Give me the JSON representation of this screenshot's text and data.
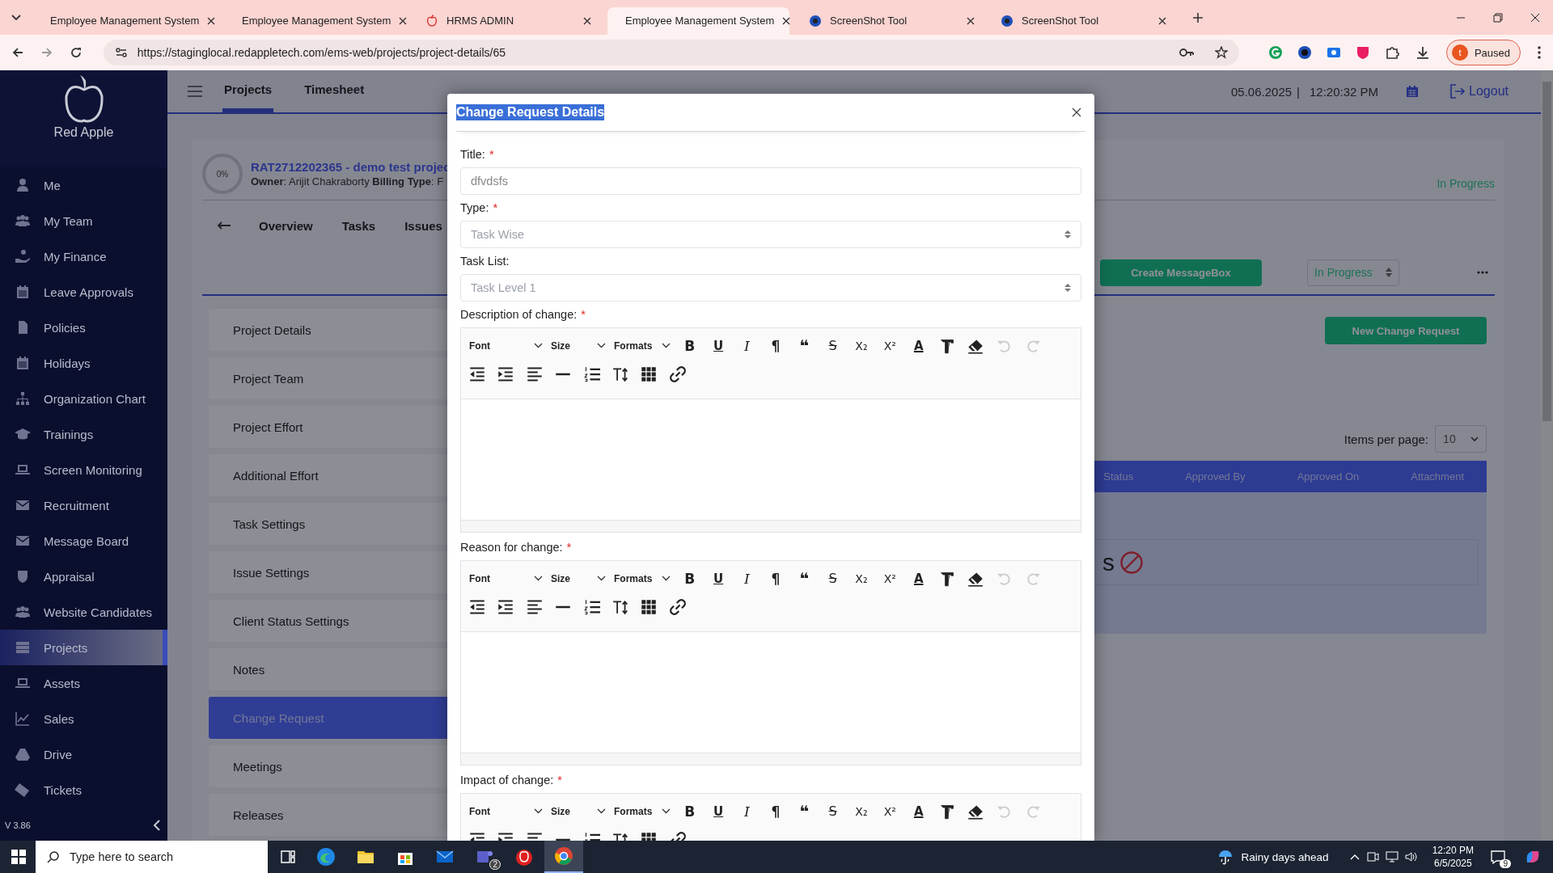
{
  "browser": {
    "tabs": [
      {
        "title": "Employee Management System",
        "selected": false
      },
      {
        "title": "Employee Management System",
        "selected": false
      },
      {
        "title": "HRMS ADMIN",
        "selected": false
      },
      {
        "title": "Employee Management System",
        "selected": true
      },
      {
        "title": "ScreenShot Tool",
        "selected": false
      },
      {
        "title": "ScreenShot Tool",
        "selected": false
      }
    ],
    "url": "https://staginglocal.redappletech.com/ems-web/projects/project-details/65",
    "profile": {
      "initial": "t",
      "status": "Paused"
    }
  },
  "sidebar": {
    "brand": "Red Apple",
    "items": [
      {
        "label": "Me",
        "selected": false
      },
      {
        "label": "My Team",
        "selected": false
      },
      {
        "label": "My Finance",
        "selected": false
      },
      {
        "label": "Leave Approvals",
        "selected": false
      },
      {
        "label": "Policies",
        "selected": false
      },
      {
        "label": "Holidays",
        "selected": false
      },
      {
        "label": "Organization Chart",
        "selected": false
      },
      {
        "label": "Trainings",
        "selected": false
      },
      {
        "label": "Screen Monitoring",
        "selected": false
      },
      {
        "label": "Recruitment",
        "selected": false
      },
      {
        "label": "Message Board",
        "selected": false
      },
      {
        "label": "Appraisal",
        "selected": false
      },
      {
        "label": "Website Candidates",
        "selected": false
      },
      {
        "label": "Projects",
        "selected": true
      },
      {
        "label": "Assets",
        "selected": false
      },
      {
        "label": "Sales",
        "selected": false
      },
      {
        "label": "Drive",
        "selected": false
      },
      {
        "label": "Tickets",
        "selected": false
      }
    ],
    "version": "V 3.86"
  },
  "header": {
    "tabs": [
      {
        "label": "Projects",
        "selected": true
      },
      {
        "label": "Timesheet",
        "selected": false
      }
    ],
    "date": "05.06.2025",
    "separator": "|",
    "time": "12:20:32 PM",
    "logout": "Logout"
  },
  "project": {
    "progress": "0%",
    "title": "RAT2712202365 - demo test projec",
    "owner_label": "Owner",
    "owner": ": Arijit Chakraborty",
    "billing_label": "Billing Type",
    "billing": ": F",
    "status": "In Progress",
    "nav": [
      "Overview",
      "Tasks",
      "Issues"
    ],
    "create_button": "Create MessageBox",
    "status_select": "In Progress",
    "menu": [
      {
        "label": "Project Details",
        "selected": false
      },
      {
        "label": "Project Team",
        "selected": false
      },
      {
        "label": "Project Effort",
        "selected": false
      },
      {
        "label": "Additional Effort",
        "selected": false
      },
      {
        "label": "Task Settings",
        "selected": false
      },
      {
        "label": "Issue Settings",
        "selected": false
      },
      {
        "label": "Client Status Settings",
        "selected": false
      },
      {
        "label": "Notes",
        "selected": false
      },
      {
        "label": "Change Request",
        "selected": true
      },
      {
        "label": "Meetings",
        "selected": false
      },
      {
        "label": "Releases",
        "selected": false
      }
    ]
  },
  "change_requests": {
    "new_button": "New Change Request",
    "items_per_page_label": "Items per page:",
    "items_per_page": "10",
    "columns": [
      "Status",
      "Approved By",
      "Approved On",
      "Attachment"
    ],
    "empty_text": "s"
  },
  "modal": {
    "title": "Change Request Details",
    "title_selected": true,
    "fields": [
      {
        "kind": "text",
        "label": "Title:",
        "required_mark": "*",
        "value": "dfvdsfs"
      },
      {
        "kind": "select",
        "label": "Type:",
        "required_mark": "*",
        "value": "Task Wise"
      },
      {
        "kind": "select",
        "label": "Task List:",
        "value": "Task Level 1"
      },
      {
        "kind": "editor",
        "label": "Description of change:",
        "required_mark": "*",
        "toolbar": {
          "dropdowns": [
            "Font",
            "Size",
            "Formats"
          ],
          "format_buttons": [
            "B",
            "U",
            "I",
            "¶",
            "❝",
            "S",
            "X₂",
            "X²",
            "A"
          ],
          "undo": {
            "disabled": true
          },
          "redo": {
            "disabled": true
          }
        }
      },
      {
        "kind": "editor",
        "label": "Reason for change:",
        "required_mark": "*",
        "toolbar": {
          "dropdowns": [
            "Font",
            "Size",
            "Formats"
          ],
          "format_buttons": [
            "B",
            "U",
            "I",
            "¶",
            "❝",
            "S",
            "X₂",
            "X²",
            "A"
          ],
          "undo": {
            "disabled": true
          },
          "redo": {
            "disabled": true
          }
        }
      },
      {
        "kind": "editor",
        "label": "Impact of change:",
        "required_mark": "*",
        "toolbar": {
          "dropdowns": [
            "Font",
            "Size",
            "Formats"
          ],
          "format_buttons": [
            "B",
            "U",
            "I",
            "¶",
            "❝",
            "S",
            "X₂",
            "X²",
            "A"
          ],
          "undo": {
            "disabled": true
          },
          "redo": {
            "disabled": true
          }
        }
      }
    ]
  },
  "taskbar": {
    "search_placeholder": "Type here to search",
    "teams_badge": "2",
    "weather": "Rainy days ahead",
    "time": "12:20 PM",
    "date": "6/5/2025",
    "notifications": "9"
  }
}
